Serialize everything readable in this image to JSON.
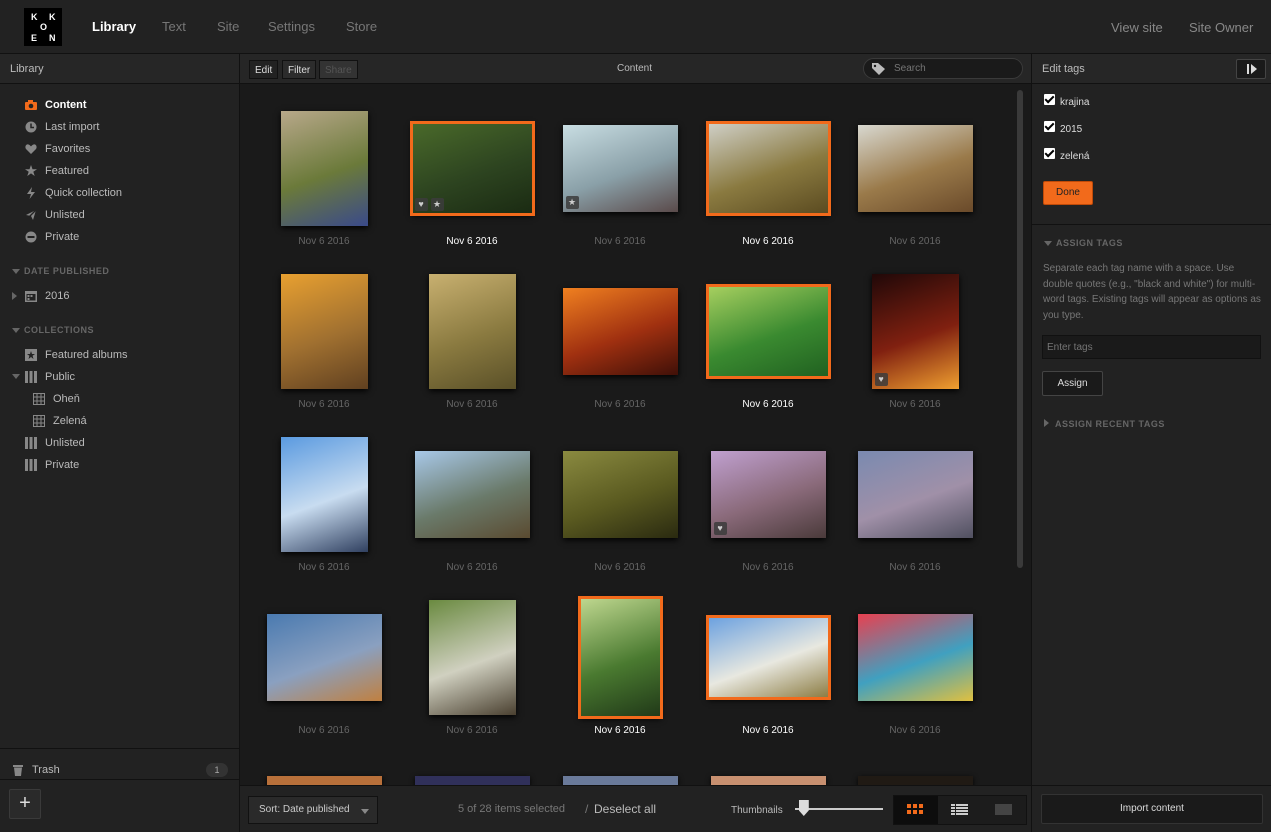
{
  "header": {
    "logo_letters": [
      "K",
      "K",
      "O",
      "E",
      "N"
    ],
    "nav": [
      "Library",
      "Text",
      "Site",
      "Settings",
      "Store"
    ],
    "view_site": "View site",
    "site_owner": "Site Owner"
  },
  "sidebar": {
    "title": "Library",
    "items": [
      {
        "label": "Content",
        "icon": "camera-icon"
      },
      {
        "label": "Last import",
        "icon": "clock-icon"
      },
      {
        "label": "Favorites",
        "icon": "heart-icon"
      },
      {
        "label": "Featured",
        "icon": "star-icon"
      },
      {
        "label": "Quick collection",
        "icon": "bolt-icon"
      },
      {
        "label": "Unlisted",
        "icon": "unlisted-icon"
      },
      {
        "label": "Private",
        "icon": "private-icon"
      }
    ],
    "date_section": "DATE PUBLISHED",
    "year": "2016",
    "collections_section": "COLLECTIONS",
    "collections": [
      "Featured albums",
      "Public",
      "Oheň",
      "Zelená",
      "Unlisted",
      "Private"
    ],
    "trash": "Trash",
    "trash_count": "1",
    "add": "+"
  },
  "toolbar": {
    "edit": "Edit",
    "filter": "Filter",
    "share": "Share",
    "title": "Content",
    "search_placeholder": "Search"
  },
  "grid": {
    "date": "Nov 6 2016",
    "items": [
      {
        "selected": false,
        "colors": [
          "#b8a88a",
          "#6b7a3a",
          "#3a4a8a"
        ],
        "badges": []
      },
      {
        "selected": true,
        "colors": [
          "#4a6a2a",
          "#2d4420",
          "#1a2a12"
        ],
        "badges": [
          "heart",
          "star"
        ]
      },
      {
        "selected": false,
        "colors": [
          "#c8dde2",
          "#8aa0a8",
          "#5a4a4a"
        ],
        "badges": [
          "star"
        ]
      },
      {
        "selected": true,
        "colors": [
          "#d0d0c8",
          "#8a7a40",
          "#5a4a20"
        ],
        "badges": []
      },
      {
        "selected": false,
        "colors": [
          "#d8d8d0",
          "#9a7a4a",
          "#6a4a2a"
        ],
        "badges": []
      },
      {
        "selected": false,
        "colors": [
          "#e8a030",
          "#a07030",
          "#604020"
        ],
        "badges": []
      },
      {
        "selected": false,
        "colors": [
          "#c8b070",
          "#8a7a40",
          "#5a5028"
        ],
        "badges": []
      },
      {
        "selected": false,
        "colors": [
          "#f08020",
          "#a03010",
          "#401008"
        ],
        "badges": []
      },
      {
        "selected": true,
        "colors": [
          "#a8d060",
          "#3a8a30",
          "#206020"
        ],
        "badges": []
      },
      {
        "selected": false,
        "colors": [
          "#200808",
          "#802010",
          "#f0a030"
        ],
        "badges": [
          "heart"
        ]
      },
      {
        "selected": false,
        "colors": [
          "#5a9ae0",
          "#c8dcf0",
          "#304060"
        ],
        "badges": []
      },
      {
        "selected": false,
        "colors": [
          "#a8c8e8",
          "#6a7a6a",
          "#5a4a30"
        ],
        "badges": []
      },
      {
        "selected": false,
        "colors": [
          "#8a8a40",
          "#5a5a20",
          "#2a2a10"
        ],
        "badges": []
      },
      {
        "selected": false,
        "colors": [
          "#c0a0d0",
          "#8a6a7a",
          "#4a3a3a"
        ],
        "badges": [
          "heart"
        ]
      },
      {
        "selected": false,
        "colors": [
          "#7a8ab0",
          "#a090a8",
          "#505060"
        ],
        "badges": []
      },
      {
        "selected": false,
        "colors": [
          "#4a7ab0",
          "#8aa0c0",
          "#c08040"
        ],
        "badges": []
      },
      {
        "selected": false,
        "colors": [
          "#6a8a40",
          "#d0d0c0",
          "#4a4030"
        ],
        "badges": []
      },
      {
        "selected": true,
        "colors": [
          "#c0d890",
          "#4a7a30",
          "#203818"
        ],
        "badges": []
      },
      {
        "selected": true,
        "colors": [
          "#6aa0e0",
          "#e8e8e0",
          "#8a7a40"
        ],
        "badges": []
      },
      {
        "selected": false,
        "colors": [
          "#e84050",
          "#40a0c0",
          "#e0c040"
        ],
        "badges": []
      }
    ]
  },
  "bottom": {
    "sort": "Sort: Date published",
    "status": "5 of 28 items selected",
    "deselect": "Deselect all",
    "thumbnails": "Thumbnails",
    "slider_level": 0.1
  },
  "right": {
    "title": "Edit tags",
    "tags": [
      "krajina",
      "2015",
      "zelená"
    ],
    "done": "Done",
    "assign_section": "ASSIGN TAGS",
    "help": "Separate each tag name with a space. Use double quotes (e.g., \"black and white\") for multi-word tags. Existing tags will appear as options as you type.",
    "enter_placeholder": "Enter tags",
    "assign": "Assign",
    "recent": "ASSIGN RECENT TAGS",
    "import": "Import content"
  },
  "colors": {
    "accent": "#f26a1b",
    "bg": "#1a1a1a",
    "panel": "#222222"
  }
}
